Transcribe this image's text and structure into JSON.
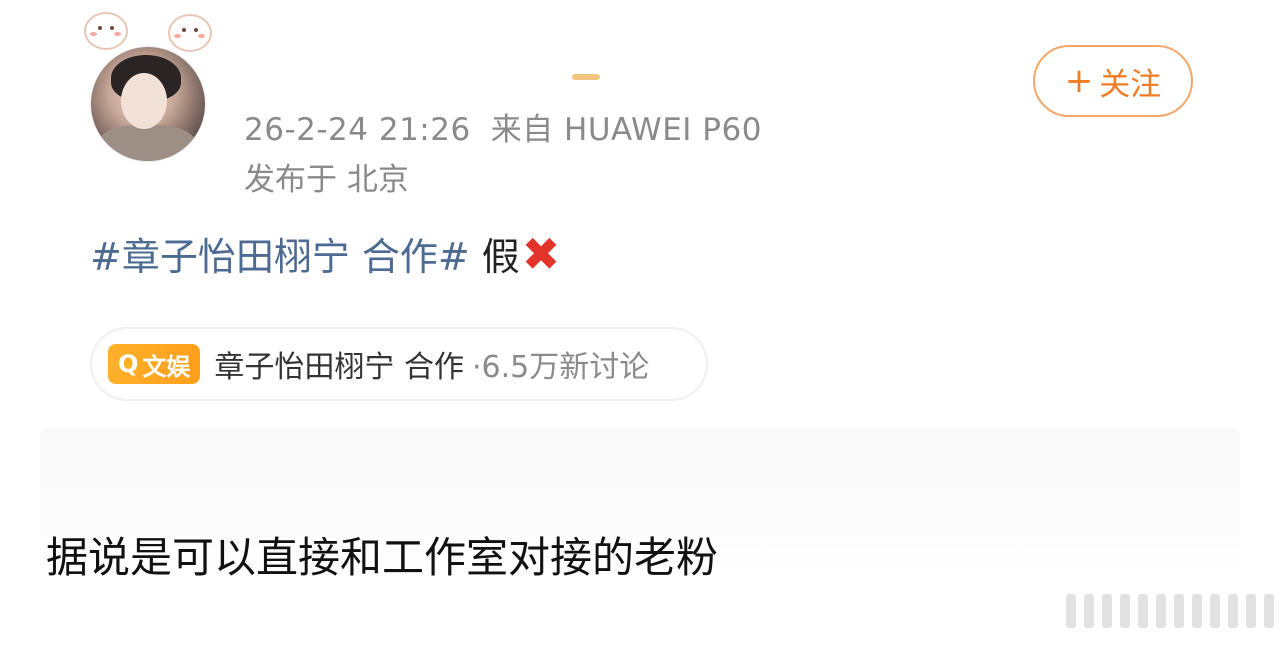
{
  "post": {
    "time": "26-2-24 21:26",
    "source": "来自 HUAWEI P60",
    "location": "发布于 北京",
    "hashtag": "#章子怡田栩宁 合作#",
    "text": "假",
    "emoji_icon": "cross-mark-icon"
  },
  "follow_button": {
    "plus": "+",
    "label": "关注"
  },
  "topic": {
    "badge_icon": "search-icon",
    "badge_label": "文娱",
    "title": "章子怡田栩宁 合作",
    "count": "·6.5万新讨论"
  },
  "caption": "据说是可以直接和工作室对接的老粉",
  "colors": {
    "accent_orange": "#ef7d26",
    "hashtag_blue": "#4d6b92",
    "meta_gray": "#8a8a8a",
    "cross_red": "#e3342b"
  }
}
